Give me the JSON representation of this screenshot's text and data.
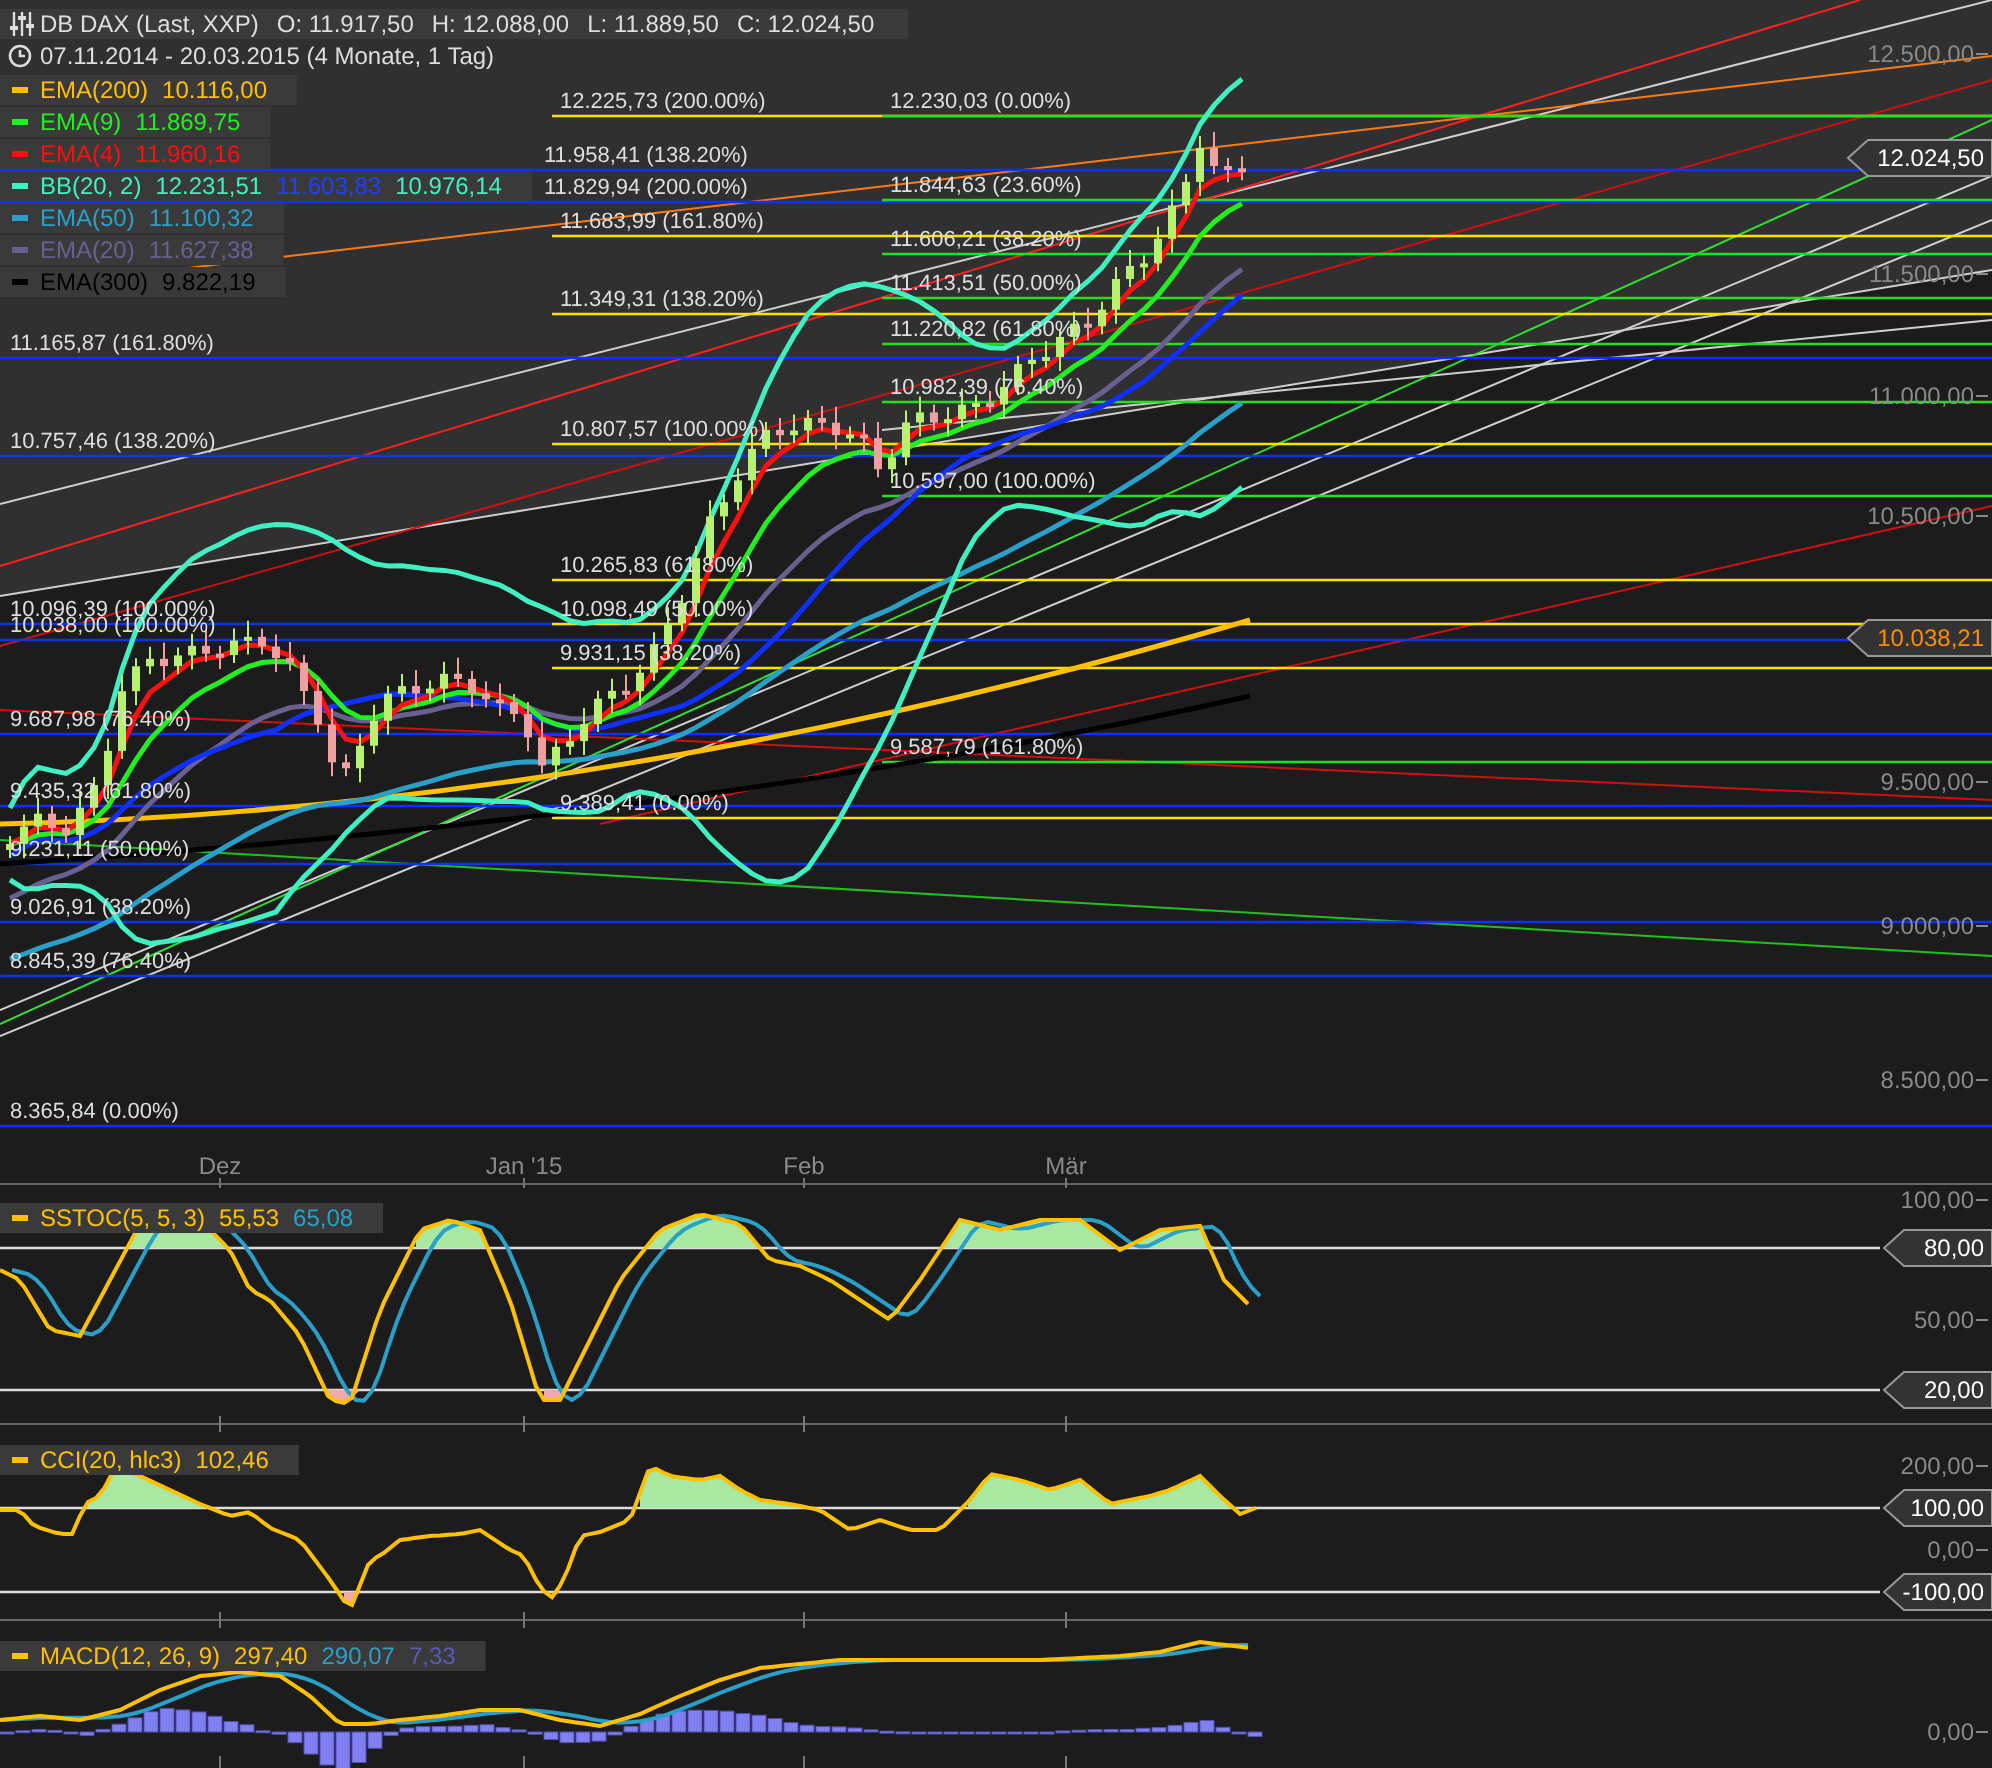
{
  "header": {
    "title": "DB DAX (Last, XXP)",
    "quotes": [
      "O: 11.917,50",
      "H: 12.088,00",
      "L: 11.889,50",
      "C: 12.024,50"
    ],
    "range": "07.11.2014 - 20.03.2015 (4 Monate, 1 Tag)"
  },
  "legend": [
    {
      "label": "EMA(200)",
      "color": "#ffc000",
      "values": [
        {
          "text": "10.116,00",
          "kind": "main"
        }
      ]
    },
    {
      "label": "EMA(9)",
      "color": "#22ee22",
      "values": [
        {
          "text": "11.869,75",
          "kind": "main"
        }
      ]
    },
    {
      "label": "EMA(4)",
      "color": "#ff1010",
      "values": [
        {
          "text": "11.960,16",
          "kind": "main"
        }
      ]
    },
    {
      "label": "BB(20, 2)",
      "color": "#40f0c0",
      "values": [
        {
          "text": "12.231,51",
          "kind": "main"
        },
        {
          "text": "11.603,83",
          "kind": "middle"
        },
        {
          "text": "10.976,14",
          "kind": "main"
        }
      ]
    },
    {
      "label": "EMA(50)",
      "color": "#2aa0c8",
      "values": [
        {
          "text": "11.100,32",
          "kind": "main"
        }
      ]
    },
    {
      "label": "EMA(20)",
      "color": "#6a6090",
      "values": [
        {
          "text": "11.627,38",
          "kind": "main"
        }
      ]
    },
    {
      "label": "EMA(300)",
      "color": "#000000",
      "values": [
        {
          "text": "9.822,19",
          "kind": "main"
        }
      ]
    }
  ],
  "fib_sets": [
    {
      "color": "#1030ff",
      "levels": [
        "11.958,41 (138.20%)",
        "11.829,94 (200.00%)",
        "11.165,87 (161.80%)",
        "10.757,46 (138.20%)",
        "10.096,39 (100.00%)",
        "10.038,00 (100.00%)",
        "9.687,98 (76.40%)",
        "9.435,32 (61.80%)",
        "9.231,11 (50.00%)",
        "9.026,91 (38.20%)",
        "8.845,39 (76.40%)",
        "8.365,84 (0.00%)"
      ]
    },
    {
      "color": "#ffe000",
      "levels": [
        "12.225,73 (200.00%)",
        "11.683,99 (161.80%)",
        "11.349,31 (138.20%)",
        "10.807,57 (100.00%)",
        "10.265,83 (61.80%)",
        "10.098,49 (50.00%)",
        "9.931,15 (38.20%)",
        "9.389,41 (0.00%)"
      ]
    },
    {
      "color": "#20e020",
      "levels": [
        "12.230,03 (0.00%)",
        "11.844,63 (23.60%)",
        "11.606,21 (38.20%)",
        "11.413,51 (50.00%)",
        "11.220,82 (61.80%)",
        "10.982,39 (76.40%)",
        "10.597,00 (100.00%)",
        "9.587,79 (161.80%)"
      ]
    }
  ],
  "price_axis": [
    "12.500,00",
    "11.500,00",
    "11.000,00",
    "10.500,00",
    "9.500,00",
    "9.000,00",
    "8.500,00"
  ],
  "price_tags": [
    {
      "text": "12.024,50",
      "color": "#ffffff"
    },
    {
      "text": "10.038,21",
      "color": "#ff8c00"
    }
  ],
  "time_axis": [
    "Dez",
    "Jan '15",
    "Feb",
    "Mär"
  ],
  "indicators": [
    {
      "kind": "sstoc",
      "label": "SSTOC(5, 5, 3)",
      "color": "#ffc000",
      "values": [
        {
          "text": "55,53",
          "kind": "main"
        },
        {
          "text": "65,08",
          "kind": "signal"
        }
      ],
      "axis": [
        "100,00",
        "50,00"
      ],
      "tags": [
        "80,00",
        "20,00"
      ]
    },
    {
      "kind": "cci",
      "label": "CCI(20, hlc3)",
      "color": "#ffc000",
      "values": [
        {
          "text": "102,46",
          "kind": "main"
        }
      ],
      "axis": [
        "200,00",
        "0,00"
      ],
      "tags": [
        "100,00",
        "-100,00"
      ]
    },
    {
      "kind": "macd",
      "label": "MACD(12, 26, 9)",
      "color": "#ffc000",
      "values": [
        {
          "text": "297,40",
          "kind": "main"
        },
        {
          "text": "290,07",
          "kind": "signal"
        },
        {
          "text": "7,33",
          "kind": "histogram"
        }
      ],
      "axis": [
        "0,00"
      ]
    }
  ]
}
